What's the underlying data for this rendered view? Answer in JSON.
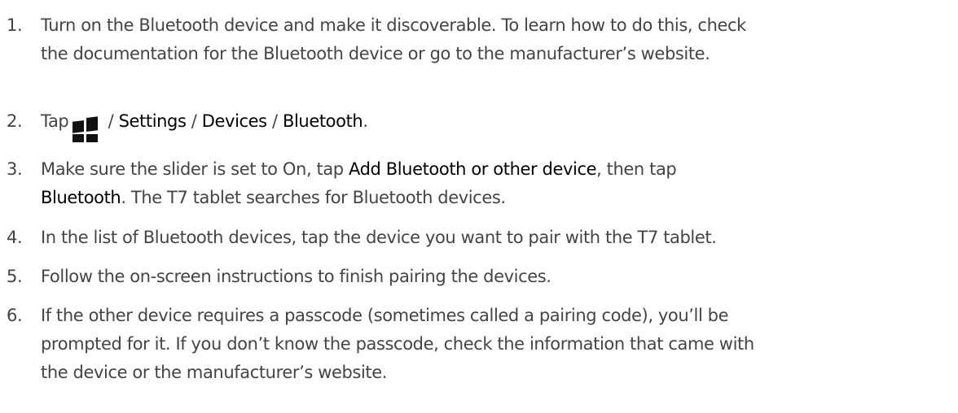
{
  "steps": [
    {
      "number": "1.",
      "lines": [
        "Turn on the Bluetooth device and make it discoverable. To learn how to do this, check",
        "the documentation for the Bluetooth device or go to the manufacturer’s website."
      ]
    },
    {
      "number": "2.",
      "tap": "Tap",
      "icon": "windows-start-icon",
      "sep1": " / ",
      "settings": "Settings",
      "sep2": " / ",
      "devices": "Devices",
      "sep3": " / ",
      "bluetooth": "Bluetooth",
      "end": "."
    },
    {
      "number": "3.",
      "line1_pre": "Make sure the slider is set to On, tap ",
      "add_device": "Add Bluetooth or other device",
      "line1_post": ", then tap",
      "bluetooth": "Bluetooth",
      "line2_post": ". The T7 tablet searches for Bluetooth devices."
    },
    {
      "number": "4.",
      "lines": [
        "In the list of Bluetooth devices, tap the device you want to pair with the T7 tablet."
      ]
    },
    {
      "number": "5.",
      "lines": [
        "Follow the on-screen instructions to finish pairing the devices."
      ]
    },
    {
      "number": "6.",
      "lines": [
        "If the other device requires a passcode (sometimes called a pairing code), you’ll be",
        "prompted for it. If you don’t know the passcode, check the information that came with",
        "the device or the manufacturer’s website."
      ]
    }
  ]
}
